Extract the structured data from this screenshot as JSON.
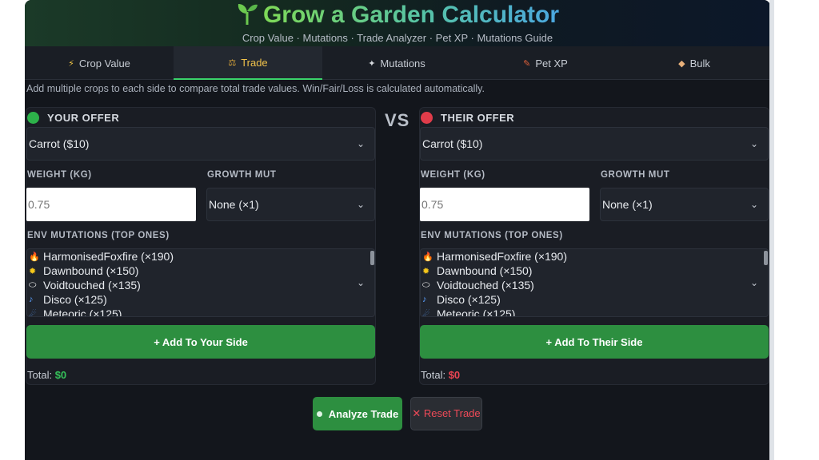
{
  "header": {
    "title": "Grow a Garden Calculator",
    "subtitle": "Crop Value · Mutations · Trade Analyzer · Pet XP · Mutations Guide",
    "icon": "sprout-icon"
  },
  "tabs": [
    {
      "label": "Crop Value",
      "icon": "lightning-icon",
      "active": false
    },
    {
      "label": "Trade",
      "icon": "scales-icon",
      "active": true
    },
    {
      "label": "Mutations",
      "icon": "wand-icon",
      "active": false
    },
    {
      "label": "Pet XP",
      "icon": "paw-icon",
      "active": false
    },
    {
      "label": "Bulk",
      "icon": "box-icon",
      "active": false
    }
  ],
  "hint": "Add multiple crops to each side to compare total trade values. Win/Fair/Loss is calculated automatically.",
  "vs_label": "VS",
  "your_offer": {
    "title": "YOUR OFFER",
    "crop": "Carrot ($10)",
    "weight_label": "WEIGHT (KG)",
    "weight_placeholder": "0.75",
    "growth_label": "GROWTH MUT",
    "growth_value": "None (×1)",
    "env_label": "ENV MUTATIONS (TOP ONES)",
    "env_items": [
      {
        "icon": "fire-fox-icon",
        "label": "HarmonisedFoxfire (×190)"
      },
      {
        "icon": "sun-icon",
        "label": "Dawnbound (×150)"
      },
      {
        "icon": "void-icon",
        "label": "Voidtouched (×135)"
      },
      {
        "icon": "disco-icon",
        "label": "Disco (×125)"
      },
      {
        "icon": "meteor-icon",
        "label": "Meteoric (×125)"
      }
    ],
    "add_button": "+ Add To Your Side",
    "total_label": "Total:",
    "total_value": "$0"
  },
  "their_offer": {
    "title": "THEIR OFFER",
    "crop": "Carrot ($10)",
    "weight_label": "WEIGHT (KG)",
    "weight_placeholder": "0.75",
    "growth_label": "GROWTH MUT",
    "growth_value": "None (×1)",
    "env_label": "ENV MUTATIONS (TOP ONES)",
    "env_items": [
      {
        "icon": "fire-fox-icon",
        "label": "HarmonisedFoxfire (×190)"
      },
      {
        "icon": "sun-icon",
        "label": "Dawnbound (×150)"
      },
      {
        "icon": "void-icon",
        "label": "Voidtouched (×135)"
      },
      {
        "icon": "disco-icon",
        "label": "Disco (×125)"
      },
      {
        "icon": "meteor-icon",
        "label": "Meteoric (×125)"
      }
    ],
    "add_button": "+ Add To Their Side",
    "total_label": "Total:",
    "total_value": "$0"
  },
  "actions": {
    "analyze": "Analyze Trade",
    "reset": "✕ Reset Trade"
  },
  "colors": {
    "accent_green": "#2d8f40",
    "your_dot": "#2db24a",
    "their_dot": "#e03c4a",
    "active_tab_text": "#f0c24b",
    "reset_text": "#ef4a58"
  }
}
